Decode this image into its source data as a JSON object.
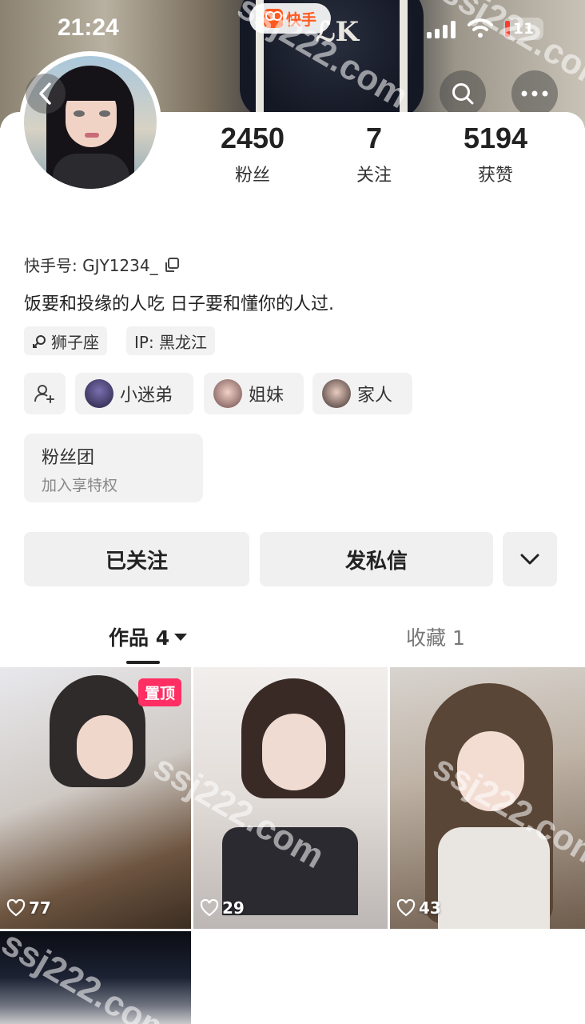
{
  "status_bar": {
    "time": "21:24",
    "app_name": "快手",
    "battery": "11"
  },
  "profile": {
    "stats": [
      {
        "value": "2450",
        "label": "粉丝"
      },
      {
        "value": "7",
        "label": "关注"
      },
      {
        "value": "5194",
        "label": "获赞"
      }
    ],
    "kuaishou_id": "快手号: GJY1234_",
    "bio": "饭要和投缘的人吃 日子要和懂你的人过.",
    "tags": [
      "狮子座",
      "IP: 黑龙江"
    ],
    "relations": [
      "小迷弟",
      "姐妹",
      "家人"
    ],
    "fan_club": {
      "title": "粉丝团",
      "subtitle": "加入享特权"
    }
  },
  "actions": {
    "following": "已关注",
    "message": "发私信"
  },
  "tabs": {
    "works": "作品 4",
    "favorites": "收藏 1"
  },
  "posts": [
    {
      "likes": "77",
      "pinned": "置顶"
    },
    {
      "likes": "29"
    },
    {
      "likes": "43"
    },
    {}
  ],
  "watermark": "ssj222.com",
  "colors": {
    "accent": "#ff2e63",
    "brand": "#ff5a1f",
    "button_bg": "#f0f0f0"
  }
}
